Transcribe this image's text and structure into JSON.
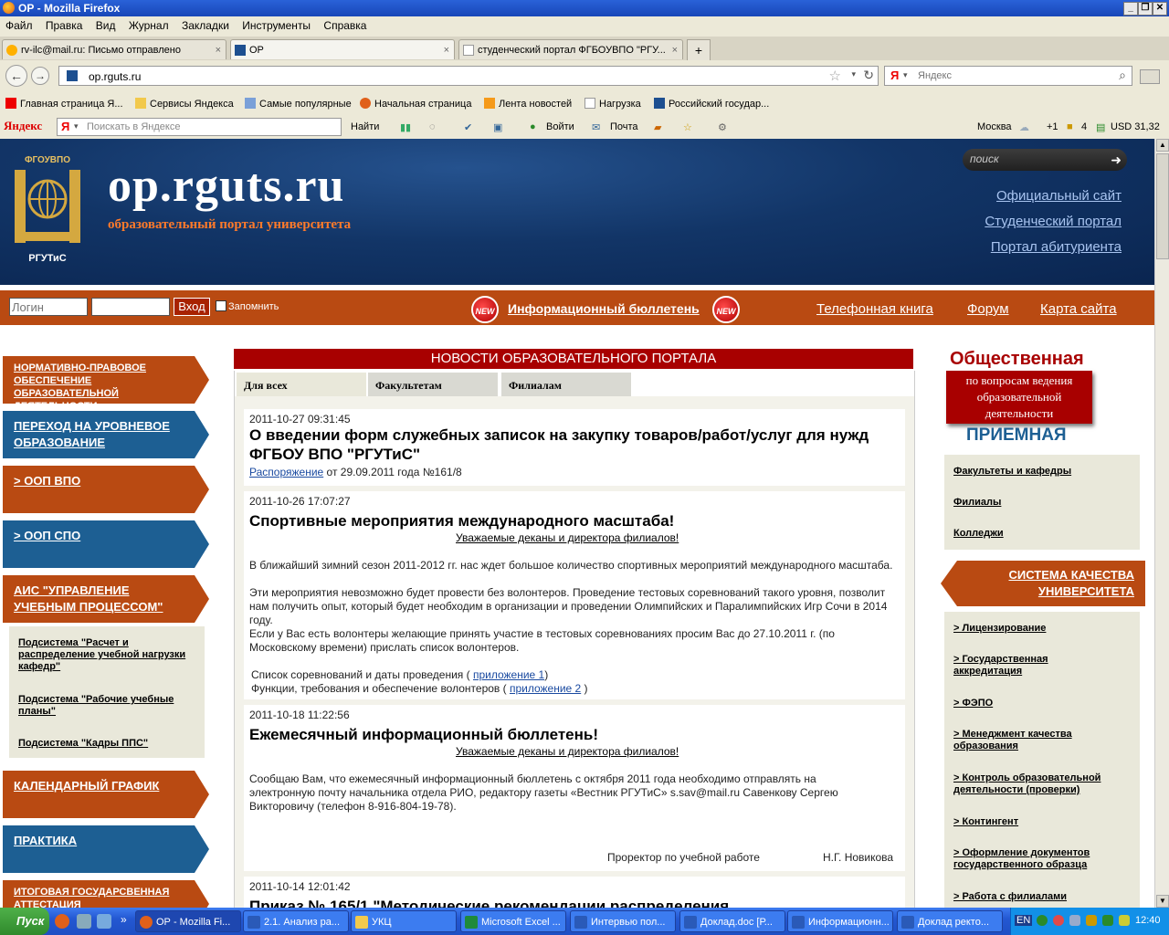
{
  "window": {
    "title": "ОР - Mozilla Firefox",
    "controls": [
      "_",
      "❐",
      "✕"
    ]
  },
  "menu": [
    "Файл",
    "Правка",
    "Вид",
    "Журнал",
    "Закладки",
    "Инструменты",
    "Справка"
  ],
  "tabs": [
    {
      "label": "rv-ilc@mail.ru: Письмо отправлено",
      "close": "×"
    },
    {
      "label": "ОР",
      "close": "×"
    },
    {
      "label": "студенческий портал ФГБОУВПО \"РГУ...",
      "close": "×"
    }
  ],
  "newtab_label": "+",
  "nav": {
    "url": "op.rguts.ru",
    "search_placeholder": "Яндекс"
  },
  "bookmarks": [
    "Главная страница Я...",
    "Сервисы Яндекса",
    "Самые популярные",
    "Начальная страница",
    "Лента новостей",
    "Нагрузка",
    "Российский государ..."
  ],
  "yandex_bar": {
    "brand": "Яндекс",
    "search_placeholder": "Поискать в Яндексе",
    "find": "Найти",
    "login": "Войти",
    "mail": "Почта",
    "city": "Москва",
    "temp": "+1",
    "count": "4",
    "usd": "USD 31,32"
  },
  "header": {
    "logo_top": "ФГОУВПО",
    "logo_bottom": "РГУТиС",
    "site_title": "op.rguts.ru",
    "site_subtitle": "образовательный портал университета",
    "search_placeholder": "поиск",
    "links": [
      "Официальный сайт",
      "Студенческий портал",
      "Портал абитуриента"
    ]
  },
  "loginbar": {
    "login_placeholder": "Логин",
    "button": "Вход",
    "remember": "Запомнить",
    "new_badge": "NEW",
    "bulletin": "Информационный бюллетень",
    "nav": [
      "Телефонная книга",
      "Форум",
      "Карта сайта"
    ]
  },
  "left_menu": [
    "НОРМАТИВНО-ПРАВОВОЕ ОБЕСПЕЧЕНИЕ ОБРАЗОВАТЕЛЬНОЙ ДЕЯТЕЛЬНОСТИ",
    "ПЕРЕХОД НА УРОВНЕВОЕ ОБРАЗОВАНИЕ",
    "> ООП ВПО",
    "> ООП СПО",
    "АИС \"УПРАВЛЕНИЕ УЧЕБНЫМ ПРОЦЕССОМ\"",
    "КАЛЕНДАРНЫЙ ГРАФИК",
    "ПРАКТИКА",
    "ИТОГОВАЯ ГОСУДАРСВЕННАЯ АТТЕСТАЦИЯ"
  ],
  "subsystems": [
    "Подсистема \"Расчет и распределение учебной нагрузки кафедр\"",
    "Подсистема \"Рабочие учебные планы\"",
    "Подсистема \"Кадры ППС\""
  ],
  "news": {
    "heading": "НОВОСТИ ОБРАЗОВАТЕЛЬНОГО ПОРТАЛА",
    "tabs": [
      "Для всех",
      "Факультетам",
      "Филиалам"
    ],
    "items": [
      {
        "date": "2011-10-27 09:31:45",
        "title": "О введении форм служебных записок на закупку товаров/работ/услуг для нужд ФГБОУ ВПО \"РГУТиС\"",
        "link": "Распоряжение",
        "text": " от 29.09.2011 года №161/8"
      },
      {
        "date": "2011-10-26 17:07:27",
        "title": "Спортивные мероприятия международного масштаба!",
        "address": "Уважаемые деканы и директора филиалов!",
        "paragraphs": [
          "В ближайший зимний сезон 2011-2012 гг. нас ждет большое количество спортивных мероприятий международного масштаба.",
          "Эти мероприятия невозможно будет провести без волонтеров. Проведение тестовых соревнований такого уровня, позволит нам получить опыт, который будет необходим в организации и проведении Олимпийских и Паралимпийских Игр Сочи в 2014 году.",
          "Если у Вас есть волонтеры желающие принять участие в тестовых соревнованиях просим Вас до 27.10.2011 г. (по Московскому времени) прислать список волонтеров."
        ],
        "list1_pre": "Список соревнований и даты проведения ( ",
        "list1_link": "приложение 1",
        "list1_post": ")",
        "list2_pre": "Функции, требования и обеспечение волонтеров ( ",
        "list2_link": "приложение 2",
        "list2_post": " )"
      },
      {
        "date": "2011-10-18 11:22:56",
        "title": "Ежемесячный информационный бюллетень!",
        "address": "Уважаемые деканы и директора филиалов!",
        "text": "Сообщаю Вам, что ежемесячный информационный бюллетень с октября 2011 года необходимо отправлять на электронную почту начальника отдела РИО, редактору газеты «Вестник РГУТиС» s.sav@mail.ru Савенкову Сергею Викторовичу (телефон 8-916-804-19-78).",
        "sign_role": "Проректор по учебной работе",
        "sign_name": "Н.Г. Новикова"
      },
      {
        "date": "2011-10-14 12:01:42",
        "title": "Приказ № 165/1 \"Методические рекомендации распределения"
      }
    ]
  },
  "right": {
    "title": "Общественная",
    "box": "по вопросам ведения образовательной деятельности",
    "subtitle": "ПРИЕМНАЯ",
    "links1": [
      "Факультеты и кафедры",
      "Филиалы",
      "Колледжи"
    ],
    "quality_button": "СИСТЕМА КАЧЕСТВА УНИВЕРСИТЕТА",
    "links2": [
      "> Лицензирование",
      "> Государственная аккредитация",
      "> ФЭПО",
      "> Менеджмент качества образования",
      "> Контроль образовательной деятельности (проверки)",
      "> Контингент",
      "> Оформление документов государственного образца",
      "> Работа с филиалами"
    ]
  },
  "taskbar": {
    "start": "Пуск",
    "tasks": [
      "ОР - Mozilla Fi...",
      "2.1. Анализ ра...",
      "УКЦ",
      "Microsoft Excel ...",
      "Интервью пол...",
      "Доклад.doc [Р...",
      "Информационн...",
      "Доклад ректо..."
    ],
    "lang": "EN",
    "clock": "12:40"
  }
}
